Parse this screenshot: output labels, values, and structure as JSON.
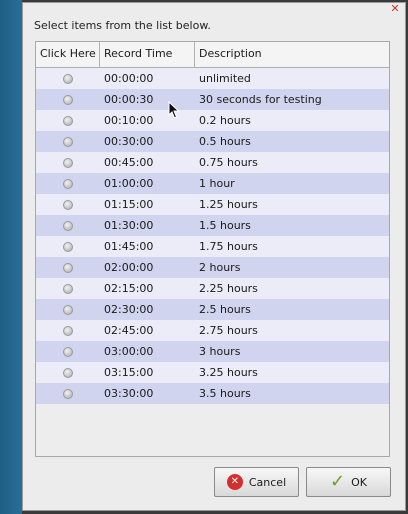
{
  "dialog": {
    "prompt": "Select items from the list below.",
    "close_icon": "close-icon"
  },
  "table": {
    "headers": [
      "Click Here",
      "Record Time",
      "Description"
    ],
    "rows": [
      {
        "time": "00:00:00",
        "desc": "unlimited"
      },
      {
        "time": "00:00:30",
        "desc": "30 seconds for testing"
      },
      {
        "time": "00:10:00",
        "desc": "0.2 hours"
      },
      {
        "time": "00:30:00",
        "desc": "0.5 hours"
      },
      {
        "time": "00:45:00",
        "desc": "0.75 hours"
      },
      {
        "time": "01:00:00",
        "desc": "1 hour"
      },
      {
        "time": "01:15:00",
        "desc": "1.25 hours"
      },
      {
        "time": "01:30:00",
        "desc": "1.5 hours"
      },
      {
        "time": "01:45:00",
        "desc": "1.75 hours"
      },
      {
        "time": "02:00:00",
        "desc": "2 hours"
      },
      {
        "time": "02:15:00",
        "desc": "2.25 hours"
      },
      {
        "time": "02:30:00",
        "desc": "2.5 hours"
      },
      {
        "time": "02:45:00",
        "desc": "2.75 hours"
      },
      {
        "time": "03:00:00",
        "desc": "3 hours"
      },
      {
        "time": "03:15:00",
        "desc": "3.25 hours"
      },
      {
        "time": "03:30:00",
        "desc": "3.5 hours"
      }
    ]
  },
  "buttons": {
    "cancel_label": "Cancel",
    "ok_label": "OK"
  },
  "colors": {
    "row_even": "#ececf8",
    "row_odd": "#d1d4ef",
    "desktop_accent": "#1f5f86"
  }
}
